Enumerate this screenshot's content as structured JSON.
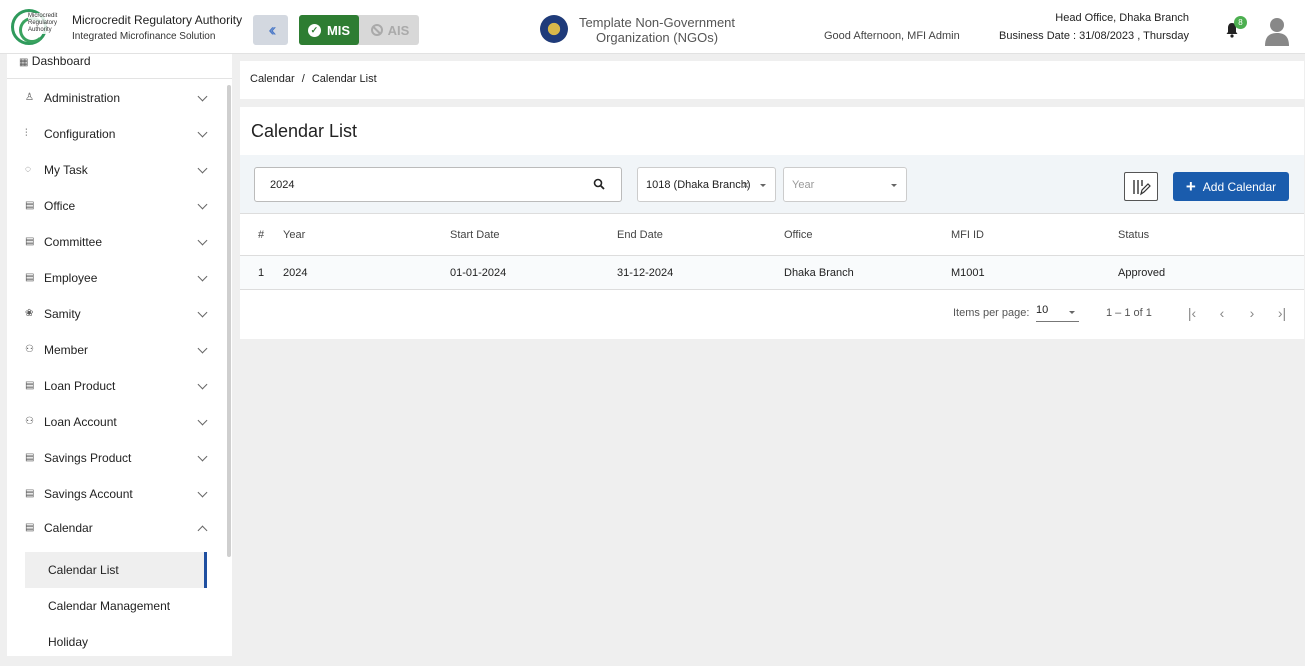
{
  "header": {
    "logo_text": "Microcredit Regulatory Authority",
    "org_title": "Microcredit Regulatory Authority",
    "org_subtitle": "Integrated Microfinance Solution",
    "mode_mis": "MIS",
    "mode_ais": "AIS",
    "ngo_name": "Template Non-Government Organization (NGOs)",
    "greeting": "Good Afternoon, MFI Admin",
    "branch": "Head Office, Dhaka Branch",
    "business_date": "Business Date : 31/08/2023 , Thursday",
    "notification_count": "8"
  },
  "sidebar": {
    "top_item": "Dashboard",
    "items": [
      {
        "label": "Administration",
        "icon": "admin-icon"
      },
      {
        "label": "Configuration",
        "icon": "sliders-icon"
      },
      {
        "label": "My Task",
        "icon": "refresh-icon"
      },
      {
        "label": "Office",
        "icon": "document-icon"
      },
      {
        "label": "Committee",
        "icon": "committee-icon"
      },
      {
        "label": "Employee",
        "icon": "employee-icon"
      },
      {
        "label": "Samity",
        "icon": "group-icon"
      },
      {
        "label": "Member",
        "icon": "member-icon"
      },
      {
        "label": "Loan Product",
        "icon": "document-icon"
      },
      {
        "label": "Loan Account",
        "icon": "member-icon"
      },
      {
        "label": "Savings Product",
        "icon": "document-icon"
      },
      {
        "label": "Savings Account",
        "icon": "document-icon"
      },
      {
        "label": "Calendar",
        "icon": "document-icon"
      }
    ],
    "sub_items": [
      "Calendar List",
      "Calendar Management",
      "Holiday"
    ]
  },
  "breadcrumb": {
    "parent": "Calendar",
    "separator": "/",
    "current": "Calendar List"
  },
  "page_title": "Calendar List",
  "filters": {
    "search_value": "2024",
    "office_value": "1018 (Dhaka Branch)",
    "year_placeholder": "Year"
  },
  "add_button_label": "Add Calendar",
  "table": {
    "headers": [
      "#",
      "Year",
      "Start Date",
      "End Date",
      "Office",
      "MFI ID",
      "Status"
    ],
    "rows": [
      [
        "1",
        "2024",
        "01-01-2024",
        "31-12-2024",
        "Dhaka Branch",
        "M1001",
        "Approved"
      ]
    ]
  },
  "paginator": {
    "items_per_page_label": "Items per page:",
    "items_per_page": "10",
    "range": "1 – 1 of 1"
  },
  "colors": {
    "accent": "#1a5cad",
    "mis_green": "#2e7d32",
    "active_border": "#1f4fa0"
  }
}
